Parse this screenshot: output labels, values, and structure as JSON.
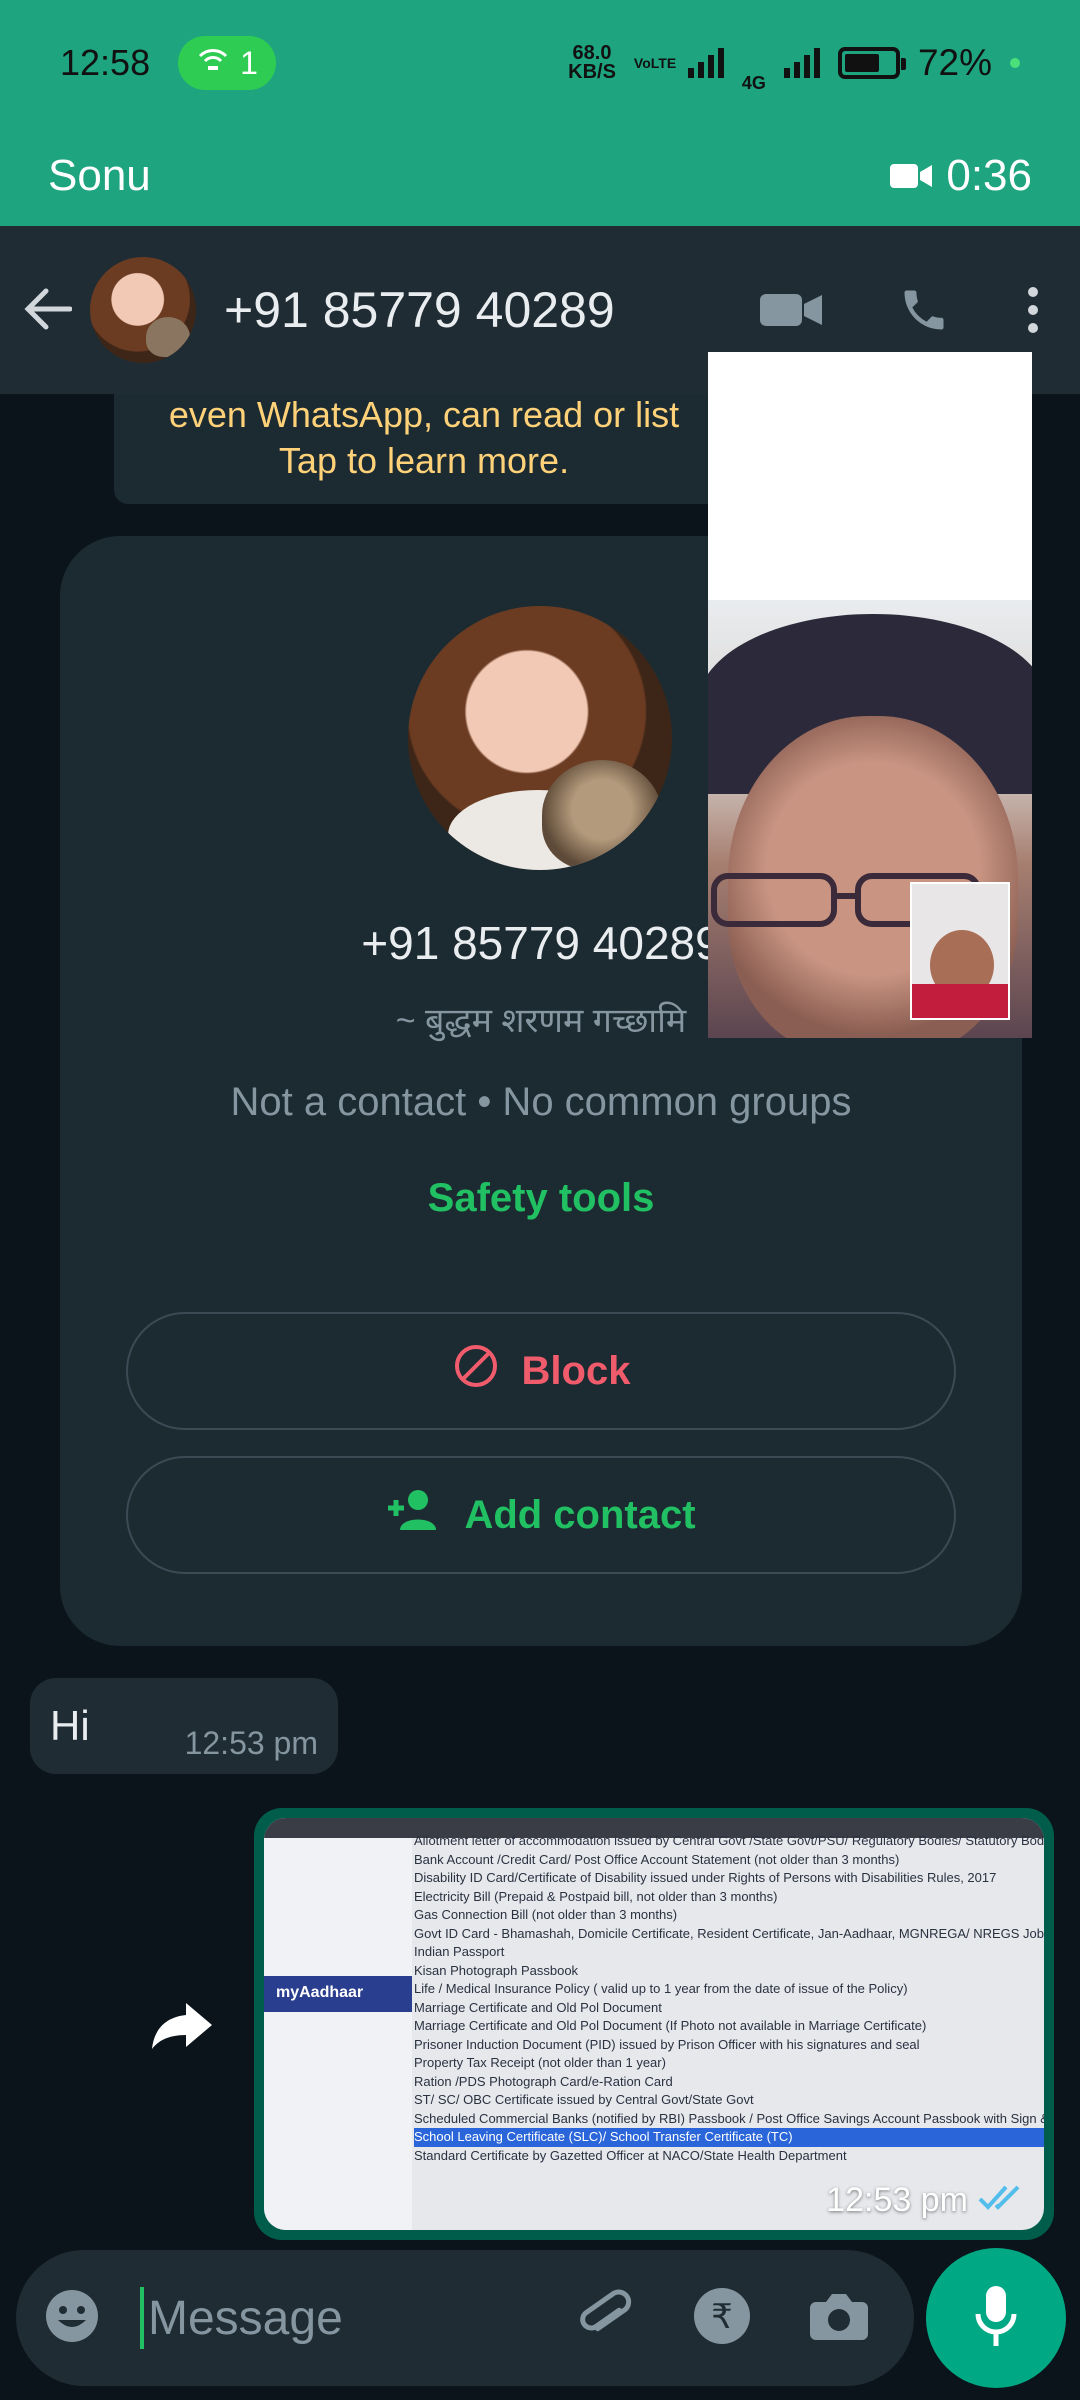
{
  "status_bar": {
    "time": "12:58",
    "hotspot_count": "1",
    "speed_value": "68.0",
    "speed_unit": "KB/S",
    "volte": "VoLTE",
    "network": "4G",
    "battery": "72%"
  },
  "call_banner": {
    "caller": "Sonu",
    "duration": "0:36"
  },
  "header": {
    "phone": "+91 85779 40289"
  },
  "encryption_notice": {
    "line1": "even WhatsApp, can read or list",
    "line2": "Tap to learn more."
  },
  "contact_card": {
    "phone": "+91 85779 40289",
    "about": "~ बुद्धम  शरणम गच्छामि",
    "meta": "Not a contact • No common groups",
    "safety": "Safety tools",
    "block_label": "Block",
    "add_label": "Add contact"
  },
  "messages": {
    "incoming_text": "Hi",
    "incoming_time": "12:53 pm",
    "outgoing_time": "12:53 pm"
  },
  "photo": {
    "brand": "myAadhaar",
    "lines": [
      "Allotment letter of accommodation issued by Central Govt /State Govt/PSU/ Regulatory Bodies/ Statutory Bodies (not more",
      "Bank Account /Credit Card/ Post Office Account Statement (not older than 3 months)",
      "Disability ID Card/Certificate of Disability issued under Rights of Persons with Disabilities Rules, 2017",
      "Electricity Bill (Prepaid & Postpaid bill, not older than 3 months)",
      "Gas Connection Bill (not older than 3 months)",
      "Govt ID Card - Bhamashah, Domicile Certificate, Resident Certificate, Jan-Aadhaar, MGNREGA/ NREGS Job Card, Labour Card",
      "Indian Passport",
      "Kisan Photograph Passbook",
      "Life / Medical Insurance Policy ( valid up to 1 year from the date of issue of the Policy)",
      "Marriage Certificate and Old Pol Document",
      "Marriage Certificate and Old Pol Document (If Photo not available in Marriage Certificate)",
      "Prisoner Induction Document (PID) issued by Prison Officer with his signatures and seal",
      "Property Tax Receipt (not older than 1 year)",
      "Ration /PDS Photograph Card/e-Ration Card",
      "ST/ SC/ OBC Certificate issued by Central Govt/State Govt",
      "Scheduled Commercial Banks (notified by RBI) Passbook / Post Office Savings Account Passbook with Sign & Stamp of issuing",
      "School Leaving Certificate (SLC)/ School Transfer Certificate (TC)",
      "Standard Certificate by Gazetted Officer at NACO/State Health Department"
    ]
  },
  "input": {
    "placeholder": "Message"
  },
  "colors": {
    "accent": "#1ea47f",
    "header_bg": "#1f2c34",
    "chat_bg": "#0b141a",
    "danger": "#f15c6d",
    "green": "#21c063"
  }
}
